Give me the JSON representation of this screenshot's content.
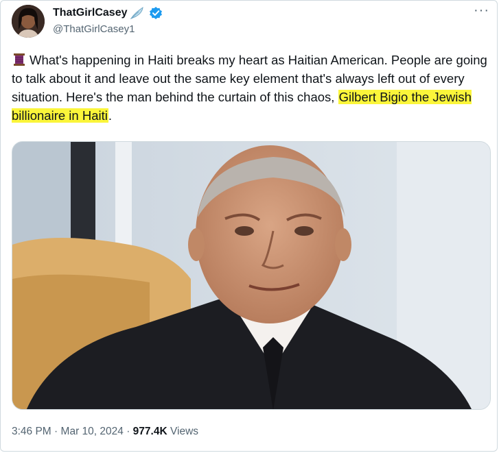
{
  "author": {
    "display_name": "ThatGirlCasey",
    "handle": "@ThatGirlCasey1",
    "name_emoji": "feather-icon",
    "verified": true,
    "verified_color": "#1d9bf0"
  },
  "tweet": {
    "text_before": "What's happening in Haiti breaks my heart as Haitian American. People are going to talk about it and leave out the same key element that's always left out of every situation. Here's the man behind the curtain of this chaos, ",
    "text_highlight": "Gilbert Bigio the Jewish billionaire in Haiti",
    "text_after": ".",
    "leading_emoji": "thread-spool-icon",
    "highlight_color": "#fbf53a"
  },
  "media": {
    "kind": "photo",
    "subject": "portrait-photo"
  },
  "meta": {
    "time": "3:46 PM",
    "separator": "·",
    "date": "Mar 10, 2024",
    "views_count": "977.4K",
    "views_label": "Views"
  },
  "actions": {
    "more_label": "···"
  }
}
